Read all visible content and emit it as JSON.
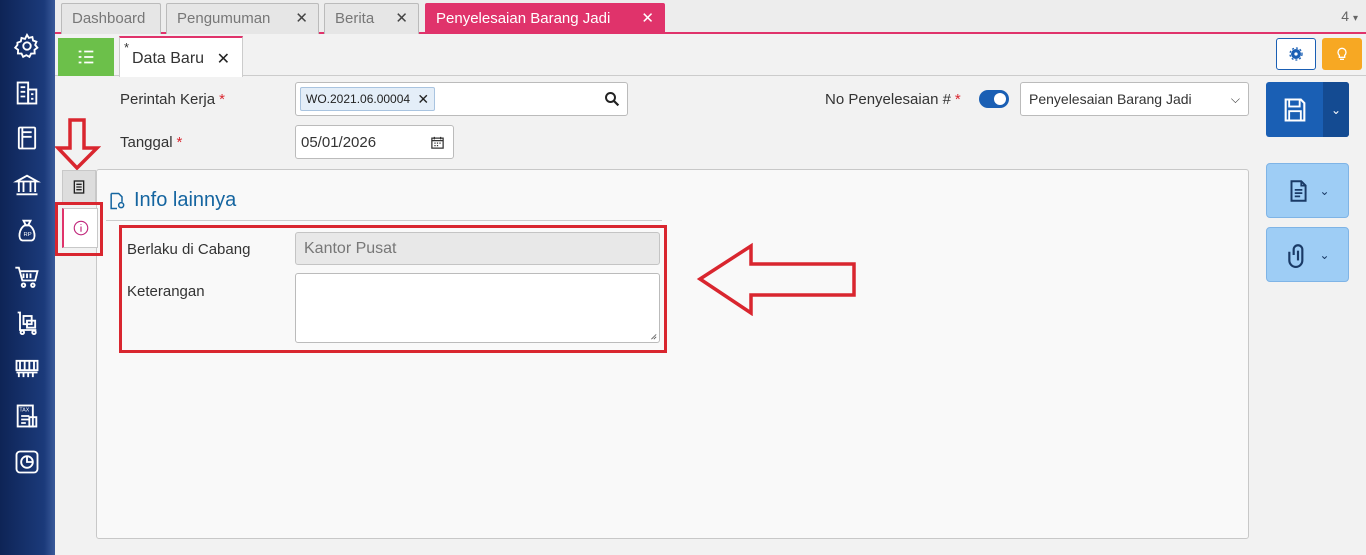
{
  "tabs": [
    {
      "label": "Dashboard",
      "closable": false,
      "active": false
    },
    {
      "label": "Pengumuman",
      "closable": true,
      "active": false
    },
    {
      "label": "Berita",
      "closable": true,
      "active": false
    },
    {
      "label": "Penyelesaian Barang Jadi",
      "closable": true,
      "active": true
    }
  ],
  "tab_count": "4",
  "close_glyph": "✕",
  "doc_tab": {
    "modified_marker": "*",
    "label": "Data Baru",
    "close": "✕"
  },
  "form": {
    "perintah_kerja_label": "Perintah Kerja",
    "perintah_kerja_value": "WO.2021.06.00004",
    "tanggal_label": "Tanggal",
    "tanggal_value": "05/01/2026",
    "no_penyelesaian_label": "No Penyelesaian #",
    "no_penyelesaian_select": "Penyelesaian Barang Jadi",
    "required_mark": "*"
  },
  "section": {
    "title": "Info lainnya",
    "berlaku_label": "Berlaku di Cabang",
    "berlaku_value": "Kantor Pusat",
    "keterangan_label": "Keterangan",
    "keterangan_value": ""
  },
  "colors": {
    "accent": "#e0336b",
    "primary": "#1a5fb4",
    "annotation_red": "#d9262f",
    "list_green": "#6cc04a",
    "bulb_orange": "#f7a823"
  },
  "sidebar_icons": [
    "gear-icon",
    "building-icon",
    "book-icon",
    "bank-icon",
    "money-bag-icon",
    "cart-icon",
    "cart-box-icon",
    "factory-icon",
    "tax-icon",
    "chart-icon"
  ]
}
